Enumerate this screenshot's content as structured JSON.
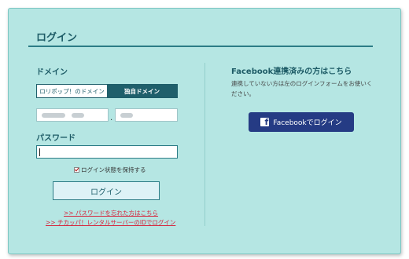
{
  "page": {
    "title": "ログイン"
  },
  "domain": {
    "label": "ドメイン",
    "options": [
      "ロリポップ！のドメイン",
      "独自ドメイン"
    ],
    "selected": "独自ドメイン"
  },
  "password": {
    "label": "パスワード",
    "value": ""
  },
  "keep_login": {
    "label": "ログイン状態を保持する",
    "checked": true
  },
  "login_button": "ログイン",
  "links": {
    "forgot_password": ">>  パスワードを忘れた方はこちら",
    "chicappa_login": ">>  チカッパ！レンタルサーバーのIDでログイン"
  },
  "facebook": {
    "title": "Facebook連携済みの方はこちら",
    "description": "連携していない方は左のログインフォームをお使いください。",
    "button": "Facebookでログイン",
    "icon": "facebook-icon",
    "brand_color": "#253b84"
  },
  "colors": {
    "panel_bg": "#b5e6e3",
    "accent": "#1f5f6b",
    "link": "#d6243c"
  }
}
